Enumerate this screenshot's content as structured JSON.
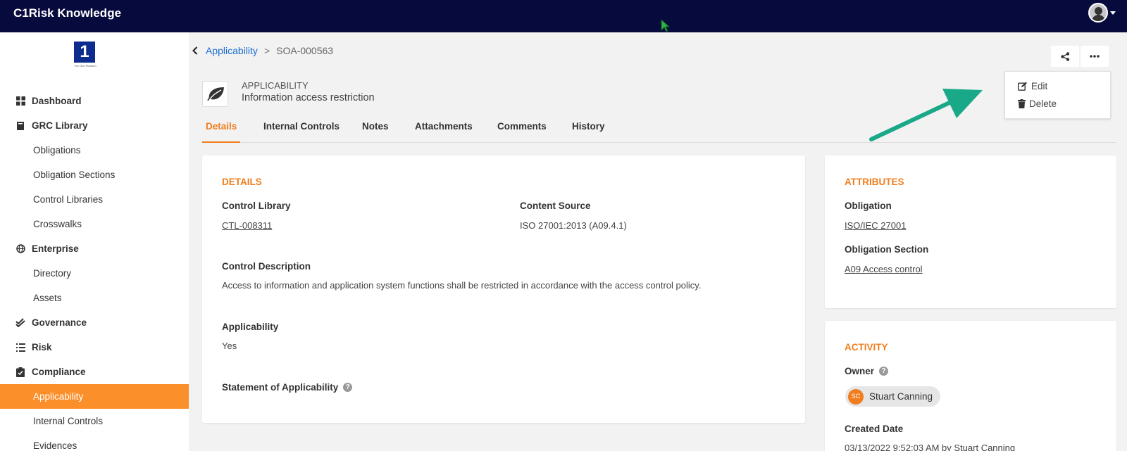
{
  "header": {
    "app_title": "C1Risk Knowledge"
  },
  "sidebar": {
    "logo_mark": "1",
    "logo_tagline": "The One Platform",
    "items": [
      {
        "label": "Dashboard"
      },
      {
        "label": "GRC Library"
      },
      {
        "label": "Obligations"
      },
      {
        "label": "Obligation Sections"
      },
      {
        "label": "Control Libraries"
      },
      {
        "label": "Crosswalks"
      },
      {
        "label": "Enterprise"
      },
      {
        "label": "Directory"
      },
      {
        "label": "Assets"
      },
      {
        "label": "Governance"
      },
      {
        "label": "Risk"
      },
      {
        "label": "Compliance"
      },
      {
        "label": "Applicability"
      },
      {
        "label": "Internal Controls"
      },
      {
        "label": "Evidences"
      }
    ]
  },
  "breadcrumb": {
    "parent": "Applicability",
    "separator": ">",
    "current": "SOA-000563"
  },
  "menu": {
    "edit": "Edit",
    "delete": "Delete"
  },
  "entity": {
    "type": "APPLICABILITY",
    "name": "Information access restriction"
  },
  "tabs": [
    {
      "label": "Details"
    },
    {
      "label": "Internal Controls"
    },
    {
      "label": "Notes"
    },
    {
      "label": "Attachments"
    },
    {
      "label": "Comments"
    },
    {
      "label": "History"
    }
  ],
  "details": {
    "title": "DETAILS",
    "control_library_label": "Control Library",
    "control_library_value": "CTL-008311",
    "content_source_label": "Content Source",
    "content_source_value": "ISO 27001:2013 (A09.4.1)",
    "control_description_label": "Control Description",
    "control_description_value": "Access to information and application system functions shall be restricted in accordance with the access control policy.",
    "applicability_label": "Applicability",
    "applicability_value": "Yes",
    "soa_label": "Statement of Applicability"
  },
  "attributes": {
    "title": "ATTRIBUTES",
    "obligation_label": "Obligation",
    "obligation_value": "ISO/IEC 27001",
    "obligation_section_label": "Obligation Section",
    "obligation_section_value": "A09 Access control"
  },
  "activity": {
    "title": "ACTIVITY",
    "owner_label": "Owner",
    "owner_initials": "SC",
    "owner_name": "Stuart Canning",
    "created_label": "Created Date",
    "created_value": "03/13/2022 9:52:03 AM by Stuart Canning"
  },
  "colors": {
    "topbar": "#060a3d",
    "accent": "#f07d1e",
    "sidebar_active": "#fb8f2a",
    "link": "#1a6dd0",
    "annotation_arrow": "#1aa988"
  },
  "icons": {
    "dashboard": "grid-icon",
    "grc_library": "book-icon",
    "enterprise": "globe-icon",
    "governance": "double-check-icon",
    "risk": "list-icon",
    "compliance": "clipboard-check-icon",
    "share": "share-icon",
    "more": "ellipsis-icon",
    "edit": "edit-icon",
    "delete": "trash-icon",
    "entity": "leaf-icon"
  }
}
